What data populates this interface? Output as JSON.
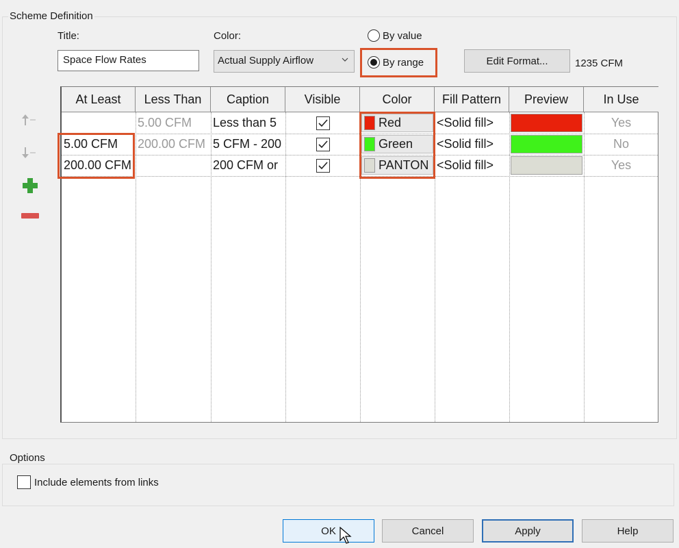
{
  "scheme": {
    "group_label": "Scheme Definition",
    "title_label": "Title:",
    "title_value": "Space Flow Rates",
    "color_label": "Color:",
    "color_value": "Actual Supply Airflow",
    "radio_by_value": "By value",
    "radio_by_range": "By range",
    "selected_mode": "By range",
    "edit_format_button": "Edit Format...",
    "format_sample": "1235 CFM"
  },
  "side_tools": {
    "move_up_icon": "move-up-icon",
    "move_down_icon": "move-down-icon",
    "add_icon": "add-icon",
    "remove_icon": "remove-icon"
  },
  "table": {
    "columns": [
      "At Least",
      "Less Than",
      "Caption",
      "Visible",
      "Color",
      "Fill Pattern",
      "Preview",
      "In Use"
    ],
    "rows": [
      {
        "at_least": "",
        "less_than": "5.00 CFM",
        "caption": "Less than 5",
        "visible": true,
        "color_name": "Red",
        "color_hex": "#e8210b",
        "fill_pattern": "<Solid fill>",
        "in_use": "Yes"
      },
      {
        "at_least": "5.00 CFM",
        "less_than": "200.00 CFM",
        "caption": "5 CFM - 200",
        "visible": true,
        "color_name": "Green",
        "color_hex": "#3ff21a",
        "fill_pattern": "<Solid fill>",
        "in_use": "No"
      },
      {
        "at_least": "200.00 CFM",
        "less_than": "",
        "caption": "200 CFM or",
        "visible": true,
        "color_name": "PANTON",
        "color_hex": "#dcddd4",
        "fill_pattern": "<Solid fill>",
        "in_use": "Yes"
      }
    ]
  },
  "options": {
    "group_label": "Options",
    "include_links_label": "Include elements from links",
    "include_links_checked": false
  },
  "buttons": {
    "ok": "OK",
    "cancel": "Cancel",
    "apply": "Apply",
    "help": "Help"
  },
  "colors": {
    "highlight": "#d9532b",
    "add_green": "#3aa23a",
    "remove_red": "#d9534f"
  }
}
